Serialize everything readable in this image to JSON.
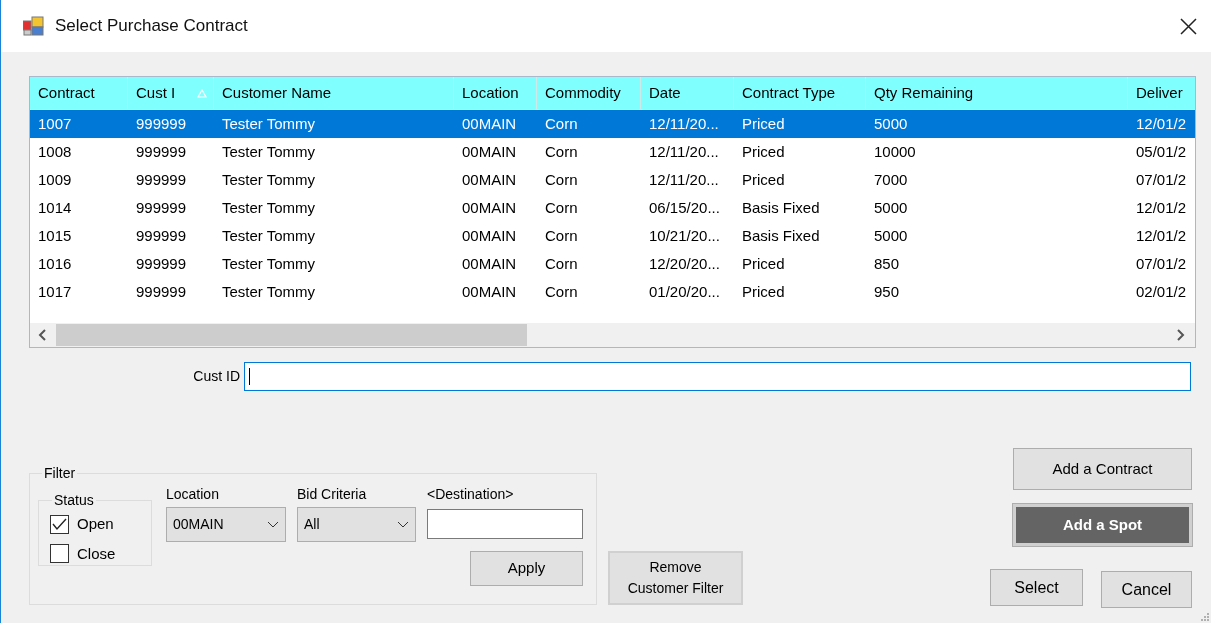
{
  "window": {
    "title": "Select Purchase Contract"
  },
  "table": {
    "columns": [
      {
        "label": "Contract",
        "sorted": false
      },
      {
        "label": "Cust I",
        "sorted": true
      },
      {
        "label": "Customer Name",
        "sorted": false
      },
      {
        "label": "Location",
        "sorted": false
      },
      {
        "label": "Commodity",
        "sorted": false
      },
      {
        "label": "Date",
        "sorted": false
      },
      {
        "label": "Contract Type",
        "sorted": false
      },
      {
        "label": "Qty Remaining",
        "sorted": false
      },
      {
        "label": "Deliver",
        "sorted": false
      }
    ],
    "rows": [
      {
        "selected": true,
        "cells": [
          "1007",
          "999999",
          "Tester Tommy",
          "00MAIN",
          "Corn",
          "12/11/20...",
          "Priced",
          "5000",
          "12/01/2"
        ]
      },
      {
        "selected": false,
        "cells": [
          "1008",
          "999999",
          "Tester Tommy",
          "00MAIN",
          "Corn",
          "12/11/20...",
          "Priced",
          "10000",
          "05/01/2"
        ]
      },
      {
        "selected": false,
        "cells": [
          "1009",
          "999999",
          "Tester Tommy",
          "00MAIN",
          "Corn",
          "12/11/20...",
          "Priced",
          "7000",
          "07/01/2"
        ]
      },
      {
        "selected": false,
        "cells": [
          "1014",
          "999999",
          "Tester Tommy",
          "00MAIN",
          "Corn",
          "06/15/20...",
          "Basis Fixed",
          "5000",
          "12/01/2"
        ]
      },
      {
        "selected": false,
        "cells": [
          "1015",
          "999999",
          "Tester Tommy",
          "00MAIN",
          "Corn",
          "10/21/20...",
          "Basis Fixed",
          "5000",
          "12/01/2"
        ]
      },
      {
        "selected": false,
        "cells": [
          "1016",
          "999999",
          "Tester Tommy",
          "00MAIN",
          "Corn",
          "12/20/20...",
          "Priced",
          "850",
          "07/01/2"
        ]
      },
      {
        "selected": false,
        "cells": [
          "1017",
          "999999",
          "Tester Tommy",
          "00MAIN",
          "Corn",
          "01/20/20...",
          "Priced",
          "950",
          "02/01/2"
        ]
      }
    ]
  },
  "cust_id": {
    "label": "Cust ID"
  },
  "filter": {
    "title": "Filter",
    "status": {
      "title": "Status",
      "options": [
        {
          "label": "Open",
          "checked": true
        },
        {
          "label": "Close",
          "checked": false
        }
      ]
    },
    "location": {
      "label": "Location",
      "value": "00MAIN"
    },
    "bid_criteria": {
      "label": "Bid Criteria",
      "value": "All"
    },
    "destination": {
      "label": "<Destination>"
    },
    "apply_button": "Apply"
  },
  "remove_filter_button": "Remove Customer Filter",
  "side_buttons": [
    {
      "label": "Add a Contract",
      "highlighted": false
    },
    {
      "label": "Add a Spot",
      "highlighted": true
    }
  ],
  "dialog_buttons": [
    "Select",
    "Cancel"
  ]
}
